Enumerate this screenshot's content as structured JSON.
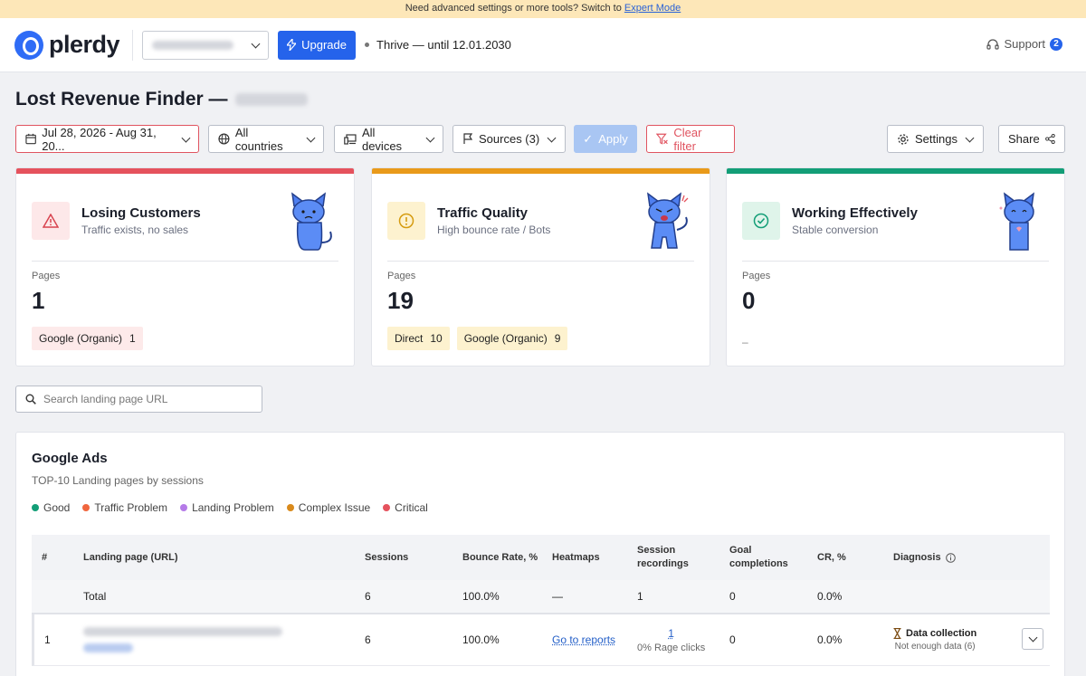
{
  "banner": {
    "text": "Need advanced settings or more tools? Switch to",
    "link": "Expert Mode"
  },
  "header": {
    "logo_text": "plerdy",
    "upgrade_label": "Upgrade",
    "plan_text": "Thrive — until 12.01.2030",
    "support_label": "Support",
    "support_count": "2"
  },
  "page": {
    "title": "Lost Revenue Finder —"
  },
  "filters": {
    "date_range": "Jul 28, 2026 - Aug 31, 20...",
    "countries": "All countries",
    "devices": "All devices",
    "sources": "Sources (3)",
    "apply": "Apply",
    "clear": "Clear filter",
    "settings": "Settings",
    "share": "Share"
  },
  "cards": [
    {
      "title": "Losing Customers",
      "subtitle": "Traffic exists, no sales",
      "pages_label": "Pages",
      "pages_value": "1",
      "accent": "#e5525d",
      "chips": [
        {
          "label": "Google (Organic)",
          "count": "1"
        }
      ]
    },
    {
      "title": "Traffic Quality",
      "subtitle": "High bounce rate / Bots",
      "pages_label": "Pages",
      "pages_value": "19",
      "accent": "#e99a1a",
      "chips": [
        {
          "label": "Direct",
          "count": "10"
        },
        {
          "label": "Google (Organic)",
          "count": "9"
        }
      ]
    },
    {
      "title": "Working Effectively",
      "subtitle": "Stable conversion",
      "pages_label": "Pages",
      "pages_value": "0",
      "accent": "#139e77",
      "empty": "–"
    }
  ],
  "search": {
    "placeholder": "Search landing page URL"
  },
  "report": {
    "title": "Google Ads",
    "subtitle": "TOP-10 Landing pages by sessions",
    "legend": [
      {
        "label": "Good",
        "color": "#139e77"
      },
      {
        "label": "Traffic Problem",
        "color": "#f0663e"
      },
      {
        "label": "Landing Problem",
        "color": "#b57be8"
      },
      {
        "label": "Complex Issue",
        "color": "#d98a1c"
      },
      {
        "label": "Critical",
        "color": "#e5525d"
      }
    ],
    "columns": {
      "num": "#",
      "url": "Landing page (URL)",
      "sessions": "Sessions",
      "bounce": "Bounce Rate, %",
      "heatmaps": "Heatmaps",
      "recordings": "Session recordings",
      "goals": "Goal completions",
      "cr": "CR, %",
      "diagnosis": "Diagnosis"
    },
    "total": {
      "label": "Total",
      "sessions": "6",
      "bounce": "100.0%",
      "heatmaps": "—",
      "recordings": "1",
      "goals": "0",
      "cr": "0.0%"
    },
    "rows": [
      {
        "num": "1",
        "sessions": "6",
        "bounce": "100.0%",
        "heatmaps": "Go to reports",
        "recordings": "1",
        "recordings_sub": "0% Rage clicks",
        "goals": "0",
        "cr": "0.0%",
        "diagnosis": "Data collection",
        "diagnosis_sub": "Not enough data (6)"
      }
    ]
  }
}
